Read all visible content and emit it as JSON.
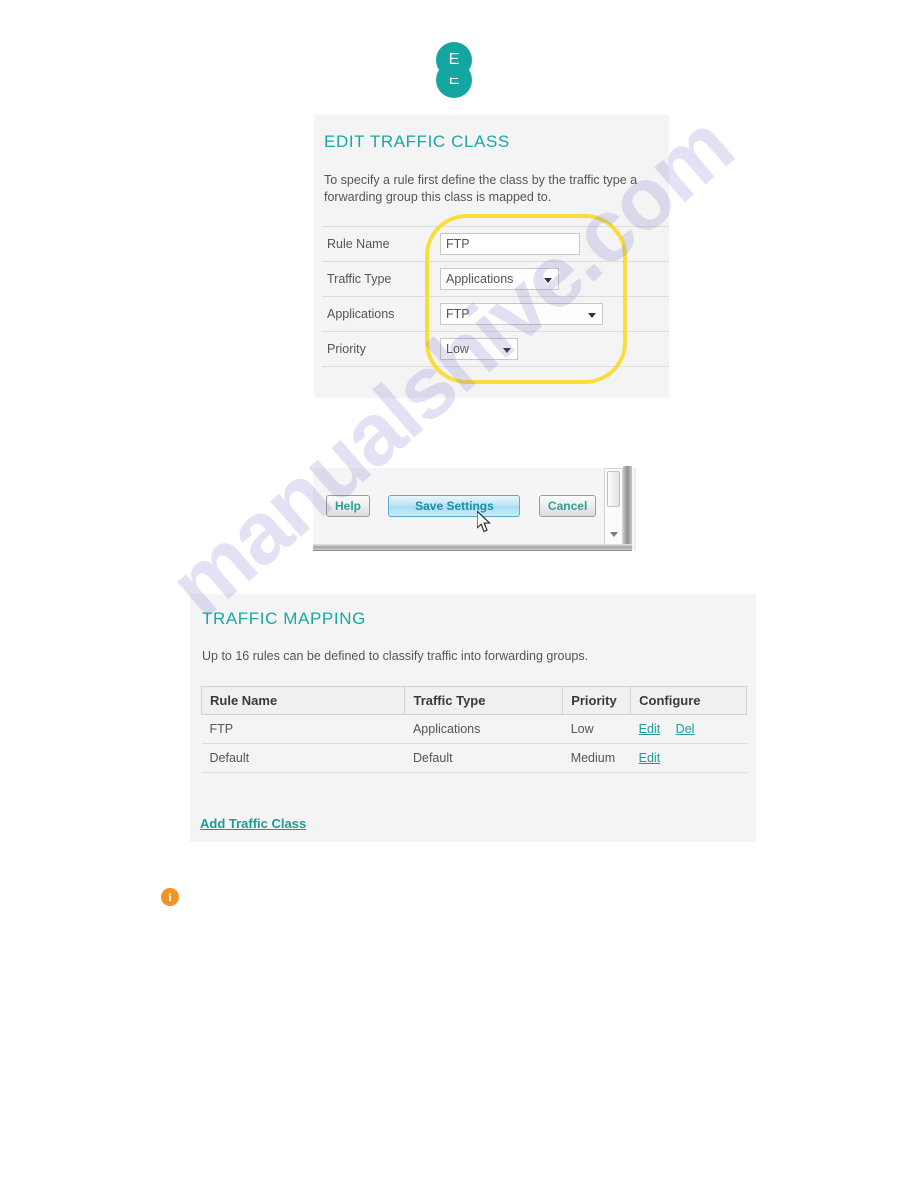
{
  "brand": {
    "logo_letter_top": "E",
    "logo_letter_bottom": "E",
    "teal": "#17A9A6",
    "orange": "#F39322",
    "highlight_yellow": "#F8DE3A"
  },
  "watermark": {
    "text": "manualshive.com"
  },
  "edit_traffic_class": {
    "title": "EDIT TRAFFIC CLASS",
    "description": "To specify a rule first define the class by the traffic type a\nforwarding group this class is mapped to.",
    "fields": [
      {
        "label": "Rule Name",
        "control": "text",
        "value": "FTP"
      },
      {
        "label": "Traffic Type",
        "control": "select",
        "value": "Applications"
      },
      {
        "label": "Applications",
        "control": "select",
        "value": "FTP"
      },
      {
        "label": "Priority",
        "control": "select",
        "value": "Low"
      }
    ]
  },
  "dialog_buttons": {
    "help": "Help",
    "save": "Save Settings",
    "cancel": "Cancel"
  },
  "traffic_mapping": {
    "title": "TRAFFIC MAPPING",
    "description": "Up to 16 rules can be defined to classify traffic into forwarding groups.",
    "columns": [
      "Rule Name",
      "Traffic Type",
      "Priority",
      "Configure"
    ],
    "rows": [
      {
        "rule_name": "FTP",
        "traffic_type": "Applications",
        "priority": "Low",
        "actions": [
          "Edit",
          "Del"
        ]
      },
      {
        "rule_name": "Default",
        "traffic_type": "Default",
        "priority": "Medium",
        "actions": [
          "Edit"
        ]
      }
    ],
    "add_link": "Add Traffic Class"
  },
  "info_note": {
    "icon": "info-icon",
    "glyph": "i"
  }
}
